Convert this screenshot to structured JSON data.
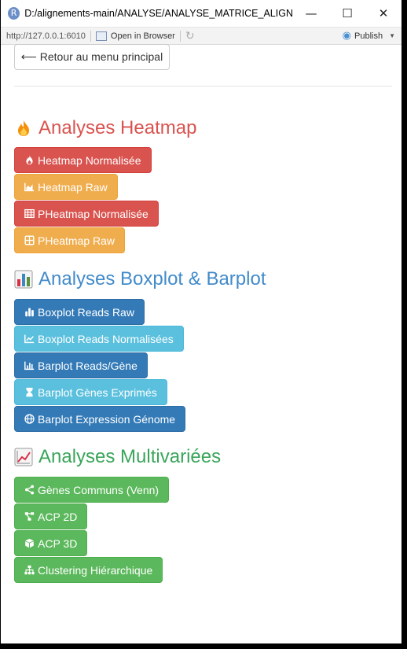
{
  "window": {
    "app_icon": "R",
    "title": "D:/alignements-main/ANALYSE/ANALYSE_MATRICE_ALIGNEM...",
    "minimize": "—",
    "maximize": "☐",
    "close": "✕"
  },
  "toolbar": {
    "url": "http://127.0.0.1:6010",
    "open_in_browser": "Open in Browser",
    "publish": "Publish"
  },
  "back_button": "⟵ Retour au menu principal",
  "sections": {
    "heatmap": {
      "title": "Analyses Heatmap",
      "color": "#d9534f",
      "buttons": [
        {
          "label": "Heatmap Normalisée",
          "icon": "fire-icon",
          "style": "danger"
        },
        {
          "label": "Heatmap Raw",
          "icon": "area-chart-icon",
          "style": "warning"
        },
        {
          "label": "PHeatmap Normalisée",
          "icon": "table-icon",
          "style": "danger"
        },
        {
          "label": "PHeatmap Raw",
          "icon": "grid-icon",
          "style": "warning"
        }
      ]
    },
    "boxplot": {
      "title": "Analyses Boxplot & Barplot",
      "color": "#428bca",
      "buttons": [
        {
          "label": "Boxplot Reads Raw",
          "icon": "bar-chart-icon",
          "style": "primary"
        },
        {
          "label": "Boxplot Reads Normalisées",
          "icon": "line-chart-icon",
          "style": "info"
        },
        {
          "label": "Barplot Reads/Gène",
          "icon": "column-chart-icon",
          "style": "primary"
        },
        {
          "label": "Barplot Gènes Exprimés",
          "icon": "hourglass-icon",
          "style": "info"
        },
        {
          "label": "Barplot Expression Génome",
          "icon": "globe-icon",
          "style": "primary"
        }
      ]
    },
    "multivariate": {
      "title": "Analyses Multivariées",
      "color": "#3aa55a",
      "buttons": [
        {
          "label": "Gènes Communs (Venn)",
          "icon": "share-nodes-icon",
          "style": "success"
        },
        {
          "label": "ACP 2D",
          "icon": "project-diagram-icon",
          "style": "success"
        },
        {
          "label": "ACP 3D",
          "icon": "cube-icon",
          "style": "success"
        },
        {
          "label": "Clustering Hiérarchique",
          "icon": "sitemap-icon",
          "style": "success"
        }
      ]
    }
  }
}
